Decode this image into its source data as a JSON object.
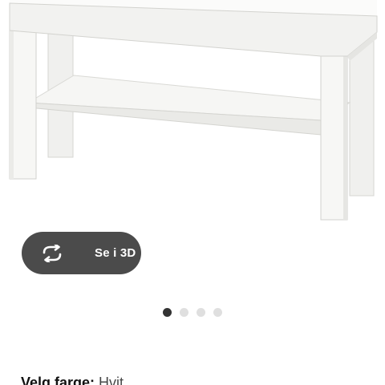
{
  "product": {
    "image_name": "tv-bench-white",
    "colors": {
      "finish": "#f4f4f2",
      "shadow": "#dcdcd8",
      "edge": "#cfcfcb"
    }
  },
  "view_3d_button": {
    "label": "Se i 3D",
    "icon": "rotate-3d-icon",
    "background": "#4b4b4b",
    "text_color": "#ffffff"
  },
  "carousel": {
    "total": 4,
    "active_index": 0,
    "active_color": "#333333",
    "inactive_color": "#dfdfdf"
  },
  "color_selector": {
    "label": "Velg farge:",
    "value": "Hvit"
  }
}
